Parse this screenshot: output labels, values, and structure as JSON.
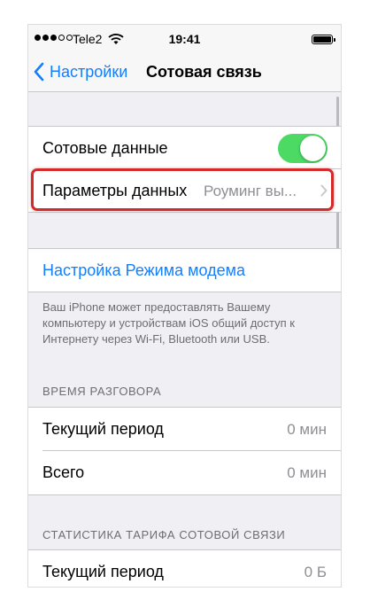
{
  "status_bar": {
    "carrier": "Tele2",
    "time": "19:41",
    "signal_bars_filled": 3,
    "signal_bars_total": 5
  },
  "nav": {
    "back_label": "Настройки",
    "title": "Сотовая связь"
  },
  "cellular_group": {
    "cellular_data_label": "Сотовые данные",
    "cellular_data_on": true,
    "data_options_label": "Параметры данных",
    "data_options_value": "Роуминг вы..."
  },
  "hotspot": {
    "link_label": "Настройка Режима модема",
    "footer_note": "Ваш iPhone может предоставлять Вашему компьютеру и устройствам iOS общий доступ к Интернету через Wi-Fi, Bluetooth или USB."
  },
  "call_time": {
    "header": "ВРЕМЯ РАЗГОВОРА",
    "rows": [
      {
        "label": "Текущий период",
        "value": "0 мин"
      },
      {
        "label": "Всего",
        "value": "0 мин"
      }
    ]
  },
  "tariff_stats": {
    "header": "СТАТИСТИКА ТАРИФА СОТОВОЙ СВЯЗИ",
    "rows": [
      {
        "label": "Текущий период",
        "value": "0 Б"
      }
    ]
  },
  "colors": {
    "accent": "#157efb",
    "toggle_on": "#4cd964",
    "highlight": "#d42a2a",
    "secondary_text": "#8e8e93"
  }
}
